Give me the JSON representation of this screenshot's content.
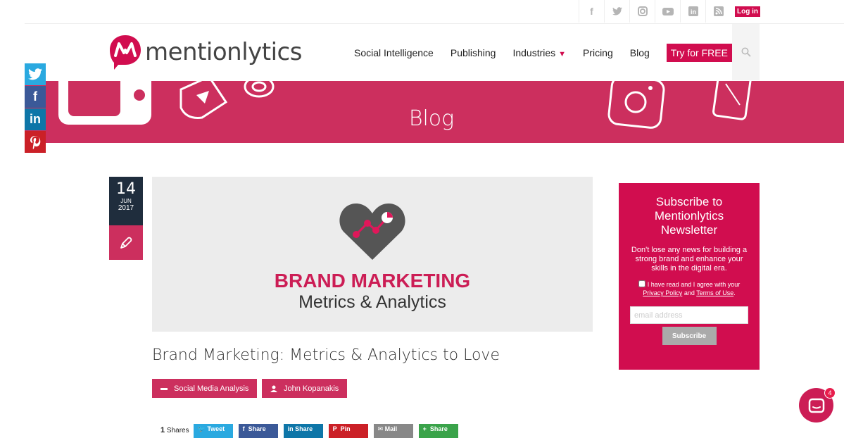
{
  "topbar": {
    "icons": [
      "facebook-icon",
      "twitter-icon",
      "instagram-icon",
      "youtube-icon",
      "linkedin-icon",
      "rss-icon"
    ],
    "login_label": "Log in"
  },
  "brand": {
    "name": "mentionlytics",
    "accent": "#d10d4f"
  },
  "nav": {
    "items": [
      "Social Intelligence",
      "Publishing",
      "Industries",
      "Pricing",
      "Blog"
    ],
    "caret": "▼",
    "cta": "Try for FREE"
  },
  "banner": {
    "title": "Blog",
    "color": "#cc2f5e"
  },
  "side_share": {
    "twitter": "",
    "facebook": "f",
    "linkedin": "in",
    "pinterest": "P"
  },
  "post": {
    "date_day": "14",
    "date_month": "JUN",
    "date_year": "2017",
    "image_headline": "BRAND MARKETING",
    "image_subline": "Metrics & Analytics",
    "title": "Brand Marketing: Metrics & Analytics to Love",
    "category": "Social Media Analysis",
    "author": "John Kopanakis",
    "share_count": "1",
    "share_count_label": "Shares",
    "share_buttons": [
      "Tweet",
      "Share",
      "Share",
      "Pin",
      "Mail",
      "Share"
    ]
  },
  "newsletter": {
    "title": "Subscribe to Mentionlytics Newsletter",
    "description": "Don't lose any news for building a strong brand and enhance your skills in the digital era.",
    "agree_prefix": "I have read and I agree with your",
    "privacy": "Privacy Policy",
    "and": "and",
    "terms": "Terms of Use",
    "email_placeholder": "email address",
    "subscribe_label": "Subscribe"
  },
  "chat": {
    "badge": "4"
  }
}
